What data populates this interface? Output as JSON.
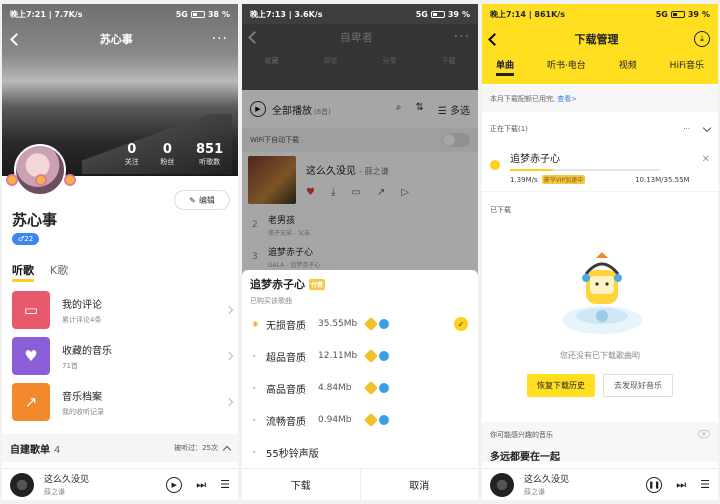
{
  "panel1": {
    "status": {
      "time": "晚上7:21",
      "speed": "7.7K/s",
      "right": "5G",
      "battery": "38"
    },
    "title": "苏心事",
    "stats": [
      {
        "value": "0",
        "label": "关注"
      },
      {
        "value": "0",
        "label": "粉丝"
      },
      {
        "value": "851",
        "label": "听歌数"
      }
    ],
    "edit_label": "编辑",
    "username": "苏心事",
    "gender_badge": "♂22",
    "tabs": [
      "听歌",
      "K歌"
    ],
    "menu": [
      {
        "main": "我的评论",
        "sub": "累计评论4条",
        "color": "#e8596b",
        "icon": "comment-icon"
      },
      {
        "main": "收藏的音乐",
        "sub": "71首",
        "color": "#8c5fd8",
        "icon": "heart-icon"
      },
      {
        "main": "音乐档案",
        "sub": "我的收听记录",
        "color": "#f28a2d",
        "icon": "chart-icon"
      }
    ],
    "section": {
      "title": "自建歌单",
      "count": "4",
      "listen": "被听过：25次"
    },
    "mini": {
      "title": "这么久没见",
      "artist": "薛之谦"
    }
  },
  "panel2": {
    "status": {
      "time": "晚上7:13",
      "speed": "3.6K/s",
      "right": "5G",
      "battery": "39"
    },
    "title": "自卑者",
    "head_icons": [
      "收藏",
      "评论",
      "分享",
      "下载"
    ],
    "play_all": "全部播放",
    "play_count": "(6首)",
    "multi": "多选",
    "wifi_label": "WiFi下自动下载",
    "current": {
      "title": "这么久没见",
      "artist": "- 薛之谦"
    },
    "songs": [
      {
        "idx": "2",
        "title": "老男孩",
        "sub": "筷子兄弟 - 父亲"
      },
      {
        "idx": "3",
        "title": "追梦赤子心",
        "sub": "GALA - 追梦赤子心"
      }
    ],
    "sheet": {
      "title": "追梦赤子心",
      "tag": "付费",
      "subtitle": "已购买该歌曲",
      "options": [
        {
          "name": "无损音质",
          "size": "35.55Mb",
          "selected": true
        },
        {
          "name": "超品音质",
          "size": "12.11Mb",
          "selected": false
        },
        {
          "name": "高品音质",
          "size": "4.84Mb",
          "selected": false
        },
        {
          "name": "流畅音质",
          "size": "0.94Mb",
          "selected": false
        },
        {
          "name": "55秒铃声版",
          "size": "",
          "selected": false
        }
      ],
      "download": "下载",
      "cancel": "取消"
    }
  },
  "panel3": {
    "status": {
      "time": "晚上7:14",
      "speed": "861K/s",
      "right": "5G",
      "battery": "39"
    },
    "title": "下载管理",
    "tabs": [
      "单曲",
      "听书·电台",
      "视频",
      "HiFi音乐"
    ],
    "quota_text": "本月下载配额已用完,",
    "quota_link": "查看>",
    "downloading": "正在下载(1)",
    "item": {
      "title": "追梦赤子心",
      "speed": "1.39M/s",
      "tag": "豪华VIP加速中",
      "size": "10.13M/35.55M",
      "progress": 0.285
    },
    "done": "已下载",
    "empty": "您还没有已下载歌曲哟",
    "restore": "恢复下载历史",
    "discover": "去发现好音乐",
    "maybe": "你可能感兴趣的音乐",
    "maybe_item": "多远都要在一起",
    "mini": {
      "title": "这么久没见",
      "artist": "薛之谦"
    }
  }
}
